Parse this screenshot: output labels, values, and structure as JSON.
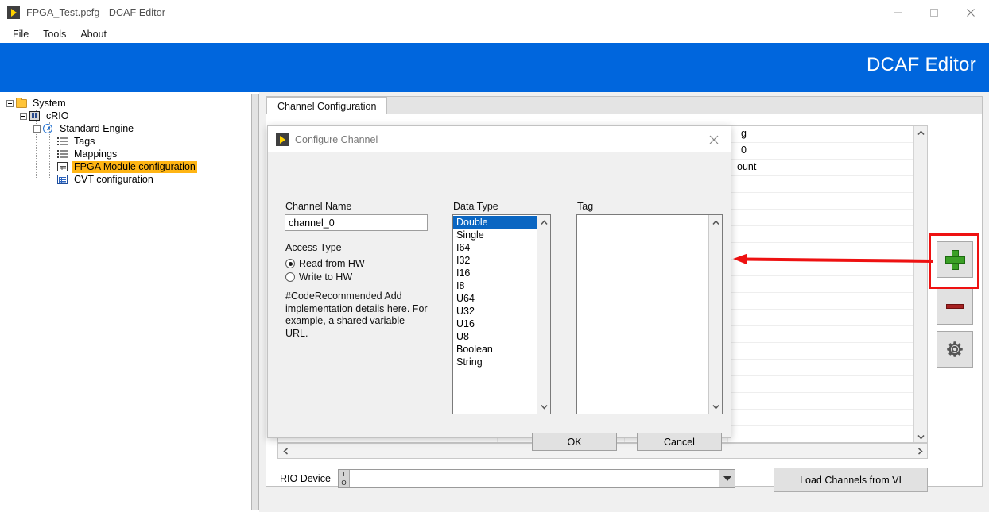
{
  "window": {
    "title": "FPGA_Test.pcfg - DCAF Editor",
    "app_icon": "labview-run-icon",
    "controls": {
      "minimize": "minimize-icon",
      "maximize": "maximize-icon",
      "close": "close-icon"
    }
  },
  "menu": {
    "items": [
      {
        "label": "File"
      },
      {
        "label": "Tools"
      },
      {
        "label": "About"
      }
    ]
  },
  "banner": {
    "title": "DCAF Editor",
    "color": "#0066dd"
  },
  "tree": {
    "items": [
      {
        "label": "System",
        "icon": "folder-icon",
        "depth": 0,
        "expander": "minus",
        "selected": false
      },
      {
        "label": "cRIO",
        "icon": "crio-chassis-icon",
        "depth": 1,
        "expander": "minus",
        "selected": false
      },
      {
        "label": "Standard Engine",
        "icon": "engine-icon",
        "depth": 2,
        "expander": "minus",
        "selected": false
      },
      {
        "label": "Tags",
        "icon": "list-icon",
        "depth": 3,
        "expander": "none",
        "selected": false
      },
      {
        "label": "Mappings",
        "icon": "list-icon",
        "depth": 3,
        "expander": "none",
        "selected": false
      },
      {
        "label": "FPGA Module configuration",
        "icon": "fpga-module-icon",
        "depth": 3,
        "expander": "none",
        "selected": true
      },
      {
        "label": "CVT configuration",
        "icon": "cvt-grid-icon",
        "depth": 3,
        "expander": "none",
        "selected": false
      }
    ],
    "selection_color": "#ffb514"
  },
  "main": {
    "tabs": [
      {
        "label": "Channel Configuration",
        "active": true
      }
    ],
    "table": {
      "rows": [
        {
          "index": 0,
          "text": "g"
        },
        {
          "index": 1,
          "text": "0"
        },
        {
          "index": 2,
          "text": "ount"
        }
      ],
      "note": "row text partially occluded by dialog"
    },
    "rio_device": {
      "label": "RIO Device",
      "value": "",
      "placeholder": "",
      "io_glyph": "I/O",
      "dropdown_icon": "chevron-down-icon"
    },
    "load_button": {
      "label": "Load Channels from VI"
    },
    "toolbar": [
      {
        "name": "add-channel-button",
        "icon": "plus-icon",
        "color": "#3ba026",
        "highlighted": true
      },
      {
        "name": "remove-channel-button",
        "icon": "minus-icon",
        "color": "#a52121",
        "highlighted": false
      },
      {
        "name": "settings-button",
        "icon": "gear-icon",
        "color": "#555555",
        "highlighted": false
      }
    ],
    "scrollbars": {
      "v_up": "chevron-up-icon",
      "v_down": "chevron-down-icon",
      "h_left": "chevron-left-icon",
      "h_right": "chevron-right-icon"
    }
  },
  "annotation": {
    "color": "#ee1111",
    "arrow": "arrow-left",
    "highlight_target": "add-channel-button"
  },
  "dialog": {
    "title": "Configure Channel",
    "icon": "labview-run-icon",
    "close_icon": "close-icon",
    "channel_name": {
      "label": "Channel Name",
      "value": "channel_0",
      "placeholder": ""
    },
    "access_type": {
      "label": "Access Type",
      "options": [
        {
          "label": "Read from HW",
          "selected": true
        },
        {
          "label": "Write to HW",
          "selected": false
        }
      ]
    },
    "note": "#CodeRecommended Add implementation details here. For example, a shared variable URL.",
    "data_type": {
      "label": "Data Type",
      "options": [
        {
          "label": "Double",
          "selected": true
        },
        {
          "label": "Single",
          "selected": false
        },
        {
          "label": "I64",
          "selected": false
        },
        {
          "label": "I32",
          "selected": false
        },
        {
          "label": "I16",
          "selected": false
        },
        {
          "label": "I8",
          "selected": false
        },
        {
          "label": "U64",
          "selected": false
        },
        {
          "label": "U32",
          "selected": false
        },
        {
          "label": "U16",
          "selected": false
        },
        {
          "label": "U8",
          "selected": false
        },
        {
          "label": "Boolean",
          "selected": false
        },
        {
          "label": "String",
          "selected": false
        }
      ],
      "selection_color": "#0a66c2"
    },
    "tag": {
      "label": "Tag",
      "options": []
    },
    "buttons": {
      "ok": "OK",
      "cancel": "Cancel"
    }
  }
}
